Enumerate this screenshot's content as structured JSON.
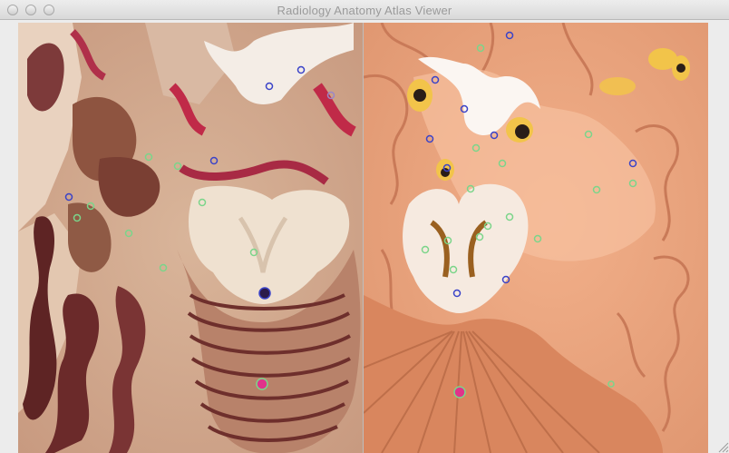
{
  "window": {
    "title": "Radiology Anatomy Atlas Viewer"
  },
  "colors": {
    "marker_blue": "#3a43c8",
    "marker_green": "#7bd58a",
    "marker_pink": "#e0338a"
  },
  "icons": [
    "close-icon",
    "minimize-icon",
    "zoom-icon",
    "resize-grip-icon"
  ]
}
